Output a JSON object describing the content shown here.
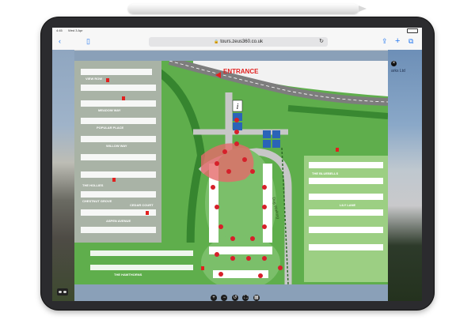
{
  "status_bar": {
    "time": "4:45",
    "date": "Wed 3 Apr"
  },
  "browser": {
    "url": "tours.zeus360.co.uk",
    "icons": {
      "back": "chevron-left-icon",
      "book": "book-icon",
      "lock": "lock-icon",
      "reload": "reload-icon",
      "share": "share-icon",
      "add": "plus-icon",
      "tabs": "tabs-icon"
    }
  },
  "tour": {
    "brand_text": "arks Ltd",
    "close_label": "×"
  },
  "map": {
    "entrance_label": "ENTRANCE",
    "dog_walk_label": "Dog Walking",
    "area_labels": {
      "view_row": "VIEW ROW",
      "meadow_way": "MEADOW WAY",
      "poplar_place": "POPULAR PLACE",
      "willow_way": "WILLOW WAY",
      "the_hollies": "THE HOLLIES",
      "chestnut_grove": "CHESTNUT GROVE",
      "cedar_court": "CEDAR COURT",
      "aspen_avenue": "ASPEN AVENUE",
      "the_hawthorns": "THE HAWTHORNS",
      "the_bluebells": "THE BLUEBELLS",
      "lily_lane": "LILY LANE"
    }
  },
  "tour_controls": [
    "+",
    "−",
    "↺",
    "⛶",
    "▦"
  ],
  "colors": {
    "grass": "#5fae4c",
    "road": "#c7c7c7",
    "pin": "#d6202a",
    "accent": "#2a7bf0"
  }
}
